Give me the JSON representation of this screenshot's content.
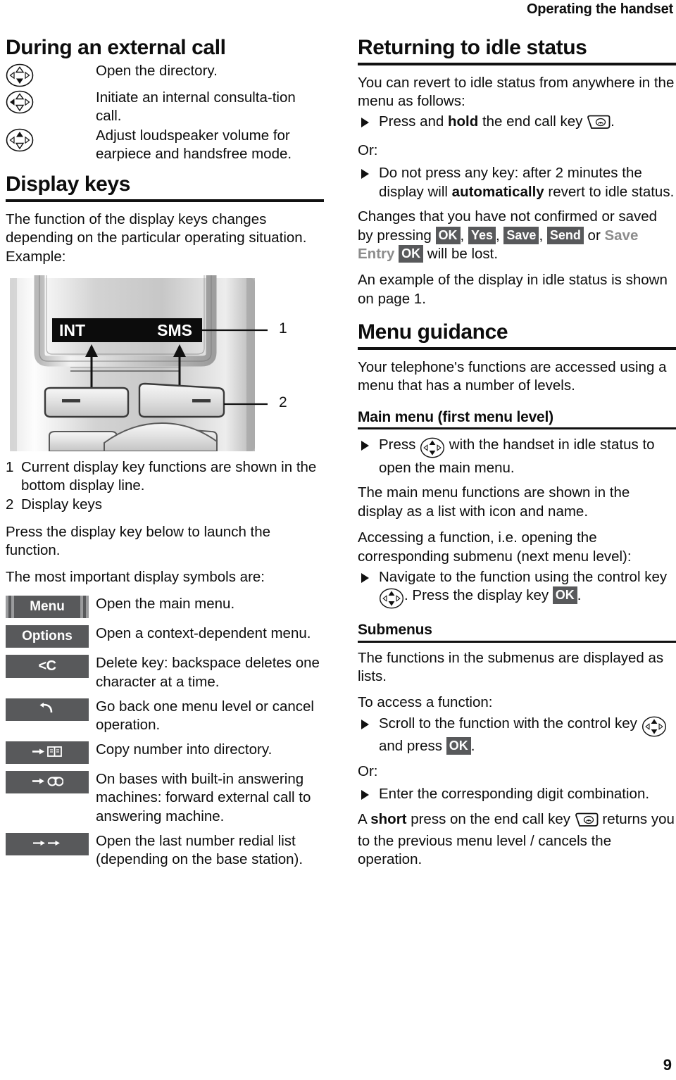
{
  "runhead": "Operating the handset",
  "page_number": "9",
  "left": {
    "section1_title": "During an external call",
    "ext_call_rows": [
      {
        "icon": "control-key-down",
        "text": "Open the directory."
      },
      {
        "icon": "control-key-left",
        "text": "Initiate an internal consulta-tion call."
      },
      {
        "icon": "control-key-up",
        "text": "Adjust loudspeaker volume for earpiece and handsfree mode."
      }
    ],
    "section2_title": "Display keys",
    "display_keys_intro": "The function of the display keys changes depending on the particular operating situation. Example:",
    "phone": {
      "lcd_left": "INT",
      "lcd_right": "SMS",
      "callout_1": "1",
      "callout_2": "2"
    },
    "legend_1_num": "1",
    "legend_1_text": "Current display key functions are shown in the bottom display line.",
    "legend_2_num": "2",
    "legend_2_text": "Display keys",
    "press_note": "Press the display key below to launch the function.",
    "symbols_intro": "The most important display symbols are:",
    "symbol_rows": [
      {
        "badge": "Menu",
        "icon": "menu-badge",
        "text": "Open the main menu."
      },
      {
        "badge": "Options",
        "icon": "options-badge",
        "text": "Open a context-dependent menu."
      },
      {
        "badge": "<C",
        "icon": "delete-key-badge",
        "text": "Delete key: backspace deletes one character at a time."
      },
      {
        "badge": "↰",
        "icon": "back-key-badge",
        "text": "Go back one menu level or cancel operation."
      },
      {
        "badge": "→ 📖",
        "icon": "copy-directory-badge",
        "text": "Copy number into directory."
      },
      {
        "badge": "→ ꙮ",
        "icon": "answering-machine-badge",
        "text": "On bases with built-in answering machines: forward external call to answering machine."
      },
      {
        "badge": "→→",
        "icon": "redial-badge",
        "text": "Open the last number redial list (depending on the base station)."
      }
    ]
  },
  "right": {
    "section1_title": "Returning to idle status",
    "p1": "You can revert to idle status from anywhere in the menu as follows:",
    "bullet1_pre": "Press and ",
    "bullet1_bold": "hold",
    "bullet1_post": " the end call key ",
    "bullet1_tail": ".",
    "or_1": "Or:",
    "bullet2_pre": "Do not press any key: after 2 minutes the display will ",
    "bullet2_bold": "automatically",
    "bullet2_post": " revert to idle status.",
    "p2_pre": "Changes that you have not confirmed or saved by pressing ",
    "p2_badges": [
      "OK",
      "Yes",
      "Save",
      "Send"
    ],
    "p2_or": " or ",
    "p2_saveentry": "Save Entry",
    "p2_ok": "OK",
    "p2_post": " will be lost.",
    "p3": "An example of the display in idle status is shown on page 1.",
    "section2_title": "Menu guidance",
    "p4": "Your telephone's functions are accessed using a menu that has a number of levels.",
    "section3_title": "Main menu (first menu level)",
    "bullet3_pre": "Press ",
    "bullet3_post": " with the handset in idle status to open the main menu.",
    "p5": "The main menu functions are shown in the display as a list with icon and name.",
    "p6": "Accessing a function, i.e. opening the corresponding submenu (next menu level):",
    "bullet4_pre": "Navigate to the function using the control key ",
    "bullet4_mid": ". Press the display key ",
    "bullet4_badge": "OK",
    "bullet4_post": ".",
    "section4_title": "Submenus",
    "p7": "The functions in the submenus are displayed as lists.",
    "p8": "To access a function:",
    "bullet5_pre": "Scroll to the function with the control key ",
    "bullet5_mid": " and press ",
    "bullet5_badge": "OK",
    "bullet5_post": ".",
    "or_2": "Or:",
    "bullet6": "Enter the corresponding digit combination.",
    "p9_pre": "A ",
    "p9_bold": "short",
    "p9_mid": " press on the end call key ",
    "p9_post": " returns you to the previous menu level / cancels the operation."
  },
  "colors": {
    "badge_bg": "#58595b",
    "badge_stripe": "#9a9b9d",
    "rule": "#111111",
    "gray_text": "#8c8c8c"
  }
}
